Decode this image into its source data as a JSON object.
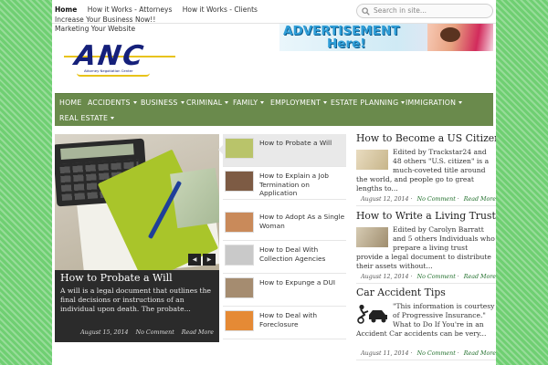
{
  "top_nav": {
    "items": [
      "Home",
      "How it Works - Attorneys",
      "How it Works - Clients",
      "Increase Your Business Now!!",
      "Marketing Your Website"
    ]
  },
  "search": {
    "placeholder": "Search in site..."
  },
  "logo": {
    "text": "ANC",
    "subtext": "Attorney Negotiation Center"
  },
  "ad": {
    "line1": "ADVERTISEMENT",
    "line2": "Here!"
  },
  "main_nav": {
    "items": [
      {
        "label": "HOME",
        "dropdown": false
      },
      {
        "label": "ACCIDENTS",
        "dropdown": true
      },
      {
        "label": "BUSINESS",
        "dropdown": true
      },
      {
        "label": "CRIMINAL",
        "dropdown": true
      },
      {
        "label": "FAMILY",
        "dropdown": true
      },
      {
        "label": "EMPLOYMENT",
        "dropdown": true
      },
      {
        "label": "ESTATE PLANNING",
        "dropdown": true
      },
      {
        "label": "IMMIGRATION",
        "dropdown": true
      },
      {
        "label": "REAL ESTATE",
        "dropdown": true
      }
    ]
  },
  "featured": {
    "title": "How to Probate a Will",
    "excerpt": "A will is a legal document that outlines the final decisions or instructions of an individual upon death. The probate...",
    "date": "August 15, 2014",
    "comments": "No Comment",
    "read_more": "Read More",
    "prev_icon": "◀",
    "next_icon": "▶"
  },
  "slider_list": [
    {
      "title": "How to Probate a Will",
      "thumb_color": "#b9c46a",
      "active": true
    },
    {
      "title": "How to Explain a Job Termination on Application",
      "thumb_color": "#7d5b44",
      "active": false
    },
    {
      "title": "How to Adopt As a Single Woman",
      "thumb_color": "#c98a5a",
      "active": false
    },
    {
      "title": "How to Deal With Collection Agencies",
      "thumb_color": "#c9c9c9",
      "active": false
    },
    {
      "title": "How to Expunge a DUI",
      "thumb_color": "#a58c70",
      "active": false
    },
    {
      "title": "How to Deal with Foreclosure",
      "thumb_color": "#e58a35",
      "active": false
    }
  ],
  "articles": [
    {
      "title": "How to Become a US Citizen",
      "body": "Edited by Trackstar24 and 48 others \"U.S. citizen\" is a much-coveted title around the world, and people go to great lengths to...",
      "date": "August 12, 2014",
      "comments": "No Comment",
      "read_more": "Read More",
      "thumb_color": "#d8c9a6"
    },
    {
      "title": "How to Write a Living Trust",
      "body": "Edited by Carolyn Barratt and 5 others Individuals who prepare a living trust provide a legal document to distribute their assets without...",
      "date": "August 12, 2014",
      "comments": "No Comment",
      "read_more": "Read More",
      "thumb_color": "#b9a98d"
    },
    {
      "title": "Car Accident Tips",
      "body": "\"This information is courtesy of Progressive Insurance.\" What to Do If You're in an Accident Car accidents can be very...",
      "date": "August 11, 2014",
      "comments": "No Comment",
      "read_more": "Read More",
      "thumb_color": "#222222"
    }
  ],
  "colors": {
    "background_green": "#6fcf72",
    "nav_green": "#6a8a4c",
    "logo_blue": "#15207a",
    "link_green": "#1f6e2a"
  }
}
